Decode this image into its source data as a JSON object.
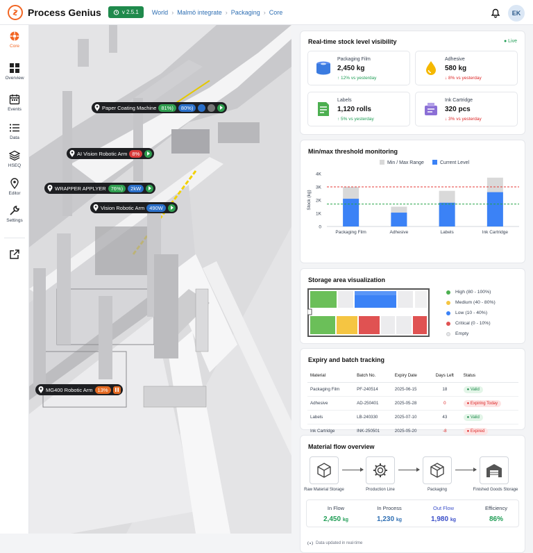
{
  "app": {
    "name": "Process Genius",
    "version": "v 2.5.1",
    "breadcrumbs": [
      "World",
      "Malmö integrate",
      "Packaging",
      "Core"
    ],
    "user_initials": "EK"
  },
  "sidebar": {
    "items": [
      {
        "label": "Core",
        "icon": "core-logo-icon",
        "active": true
      },
      {
        "label": "Overview",
        "icon": "grid-icon"
      },
      {
        "label": "Events",
        "icon": "calendar-icon"
      },
      {
        "label": "Data",
        "icon": "list-icon"
      },
      {
        "label": "HSEQ",
        "icon": "layers-icon"
      },
      {
        "label": "Editor",
        "icon": "map-pin-icon"
      },
      {
        "label": "Settings",
        "icon": "wrench-icon"
      }
    ],
    "external_icon": "external-link-icon"
  },
  "machines": [
    {
      "name": "Paper Coating Machine",
      "values": [
        "81%)",
        "80%)"
      ]
    },
    {
      "name": "AI Vision Robotic Arm",
      "values": [
        "8%"
      ]
    },
    {
      "name": "WRAPPER APPLYER",
      "values": [
        "76%)",
        "2kW"
      ]
    },
    {
      "name": "Vision Robotic Arm",
      "values": [
        "490W"
      ]
    },
    {
      "name": "MG400 Robotic Arm",
      "values": [
        "13%"
      ]
    }
  ],
  "stock": {
    "title": "Real-time stock level visibility",
    "live": "Live",
    "items": [
      {
        "name": "Packaging Film",
        "value": "2,450 kg",
        "change": "↑ 12% vs yesterday",
        "dir": "up"
      },
      {
        "name": "Adhesive",
        "value": "580 kg",
        "change": "↓ 8% vs yesterday",
        "dir": "down"
      },
      {
        "name": "Labels",
        "value": "1,120 rolls",
        "change": "↑ 5% vs yesterday",
        "dir": "up"
      },
      {
        "name": "Ink Cartridge",
        "value": "320 pcs",
        "change": "↓ 3% vs yesterday",
        "dir": "down"
      }
    ]
  },
  "threshold": {
    "title": "Min/max threshold monitoring",
    "legend": [
      "Min / Max Range",
      "Current Level"
    ]
  },
  "chart_data": {
    "type": "bar",
    "categories": [
      "Packaging Film",
      "Adhesive",
      "Labels",
      "Ink Cartridge"
    ],
    "series": [
      {
        "name": "Min / Max Range",
        "values": [
          3000,
          1500,
          2700,
          3700
        ],
        "color": "#d9d9d9"
      },
      {
        "name": "Current Level",
        "values": [
          2100,
          1050,
          1800,
          2600
        ],
        "color": "#3b82f6"
      }
    ],
    "ylabel": "Stock (kg)",
    "yticks": [
      "0",
      "1K",
      "2K",
      "3K",
      "4K"
    ],
    "ylim": [
      0,
      4000
    ],
    "max_line": 3000,
    "min_line": 1700,
    "grid": false,
    "legend_position": "top"
  },
  "storage": {
    "title": "Storage area visualization",
    "legend": [
      {
        "label": "High (80 - 100%)",
        "color": "#4caf50"
      },
      {
        "label": "Medium (40 - 80%)",
        "color": "#f5c542"
      },
      {
        "label": "Low (10 - 40%)",
        "color": "#3b82f6"
      },
      {
        "label": "Critical (0 - 10%)",
        "color": "#e05252"
      },
      {
        "label": "Empty",
        "color": "#e5e7eb"
      }
    ]
  },
  "expiry": {
    "title": "Expiry and batch tracking",
    "headers": [
      "Material",
      "Batch No.",
      "Expiry Date",
      "Days Left",
      "Status"
    ],
    "rows": [
      {
        "material": "Packaging Film",
        "batch": "PF-240514",
        "date": "2025-06-15",
        "days": "18",
        "status": "● Valid",
        "kind": "valid"
      },
      {
        "material": "Adhesive",
        "batch": "AD-250401",
        "date": "2025-05-28",
        "days": "0",
        "status": "● Expiring Today",
        "kind": "soon"
      },
      {
        "material": "Labels",
        "batch": "LB-240330",
        "date": "2025-07-10",
        "days": "43",
        "status": "● Valid",
        "kind": "valid"
      },
      {
        "material": "Ink Cartridge",
        "batch": "INK-250501",
        "date": "2025-05-20",
        "days": "-8",
        "status": "● Expired",
        "kind": "exp"
      }
    ]
  },
  "flow": {
    "title": "Material flow overview",
    "steps": [
      {
        "label": "Raw Material Storage",
        "icon": "box-icon"
      },
      {
        "label": "Production Line",
        "icon": "gear-icon"
      },
      {
        "label": "Packaging",
        "icon": "package-icon"
      },
      {
        "label": "Finished Goods Storage",
        "icon": "warehouse-icon"
      }
    ],
    "stats": [
      {
        "label": "In Flow",
        "value": "2,450",
        "unit": "kg"
      },
      {
        "label": "In Process",
        "value": "1,230",
        "unit": "kg"
      },
      {
        "label": "Out Flow",
        "value": "1,980",
        "unit": "kg"
      },
      {
        "label": "Efficiency",
        "value": "86%",
        "unit": ""
      }
    ],
    "footer": "Data updated in real-time"
  }
}
